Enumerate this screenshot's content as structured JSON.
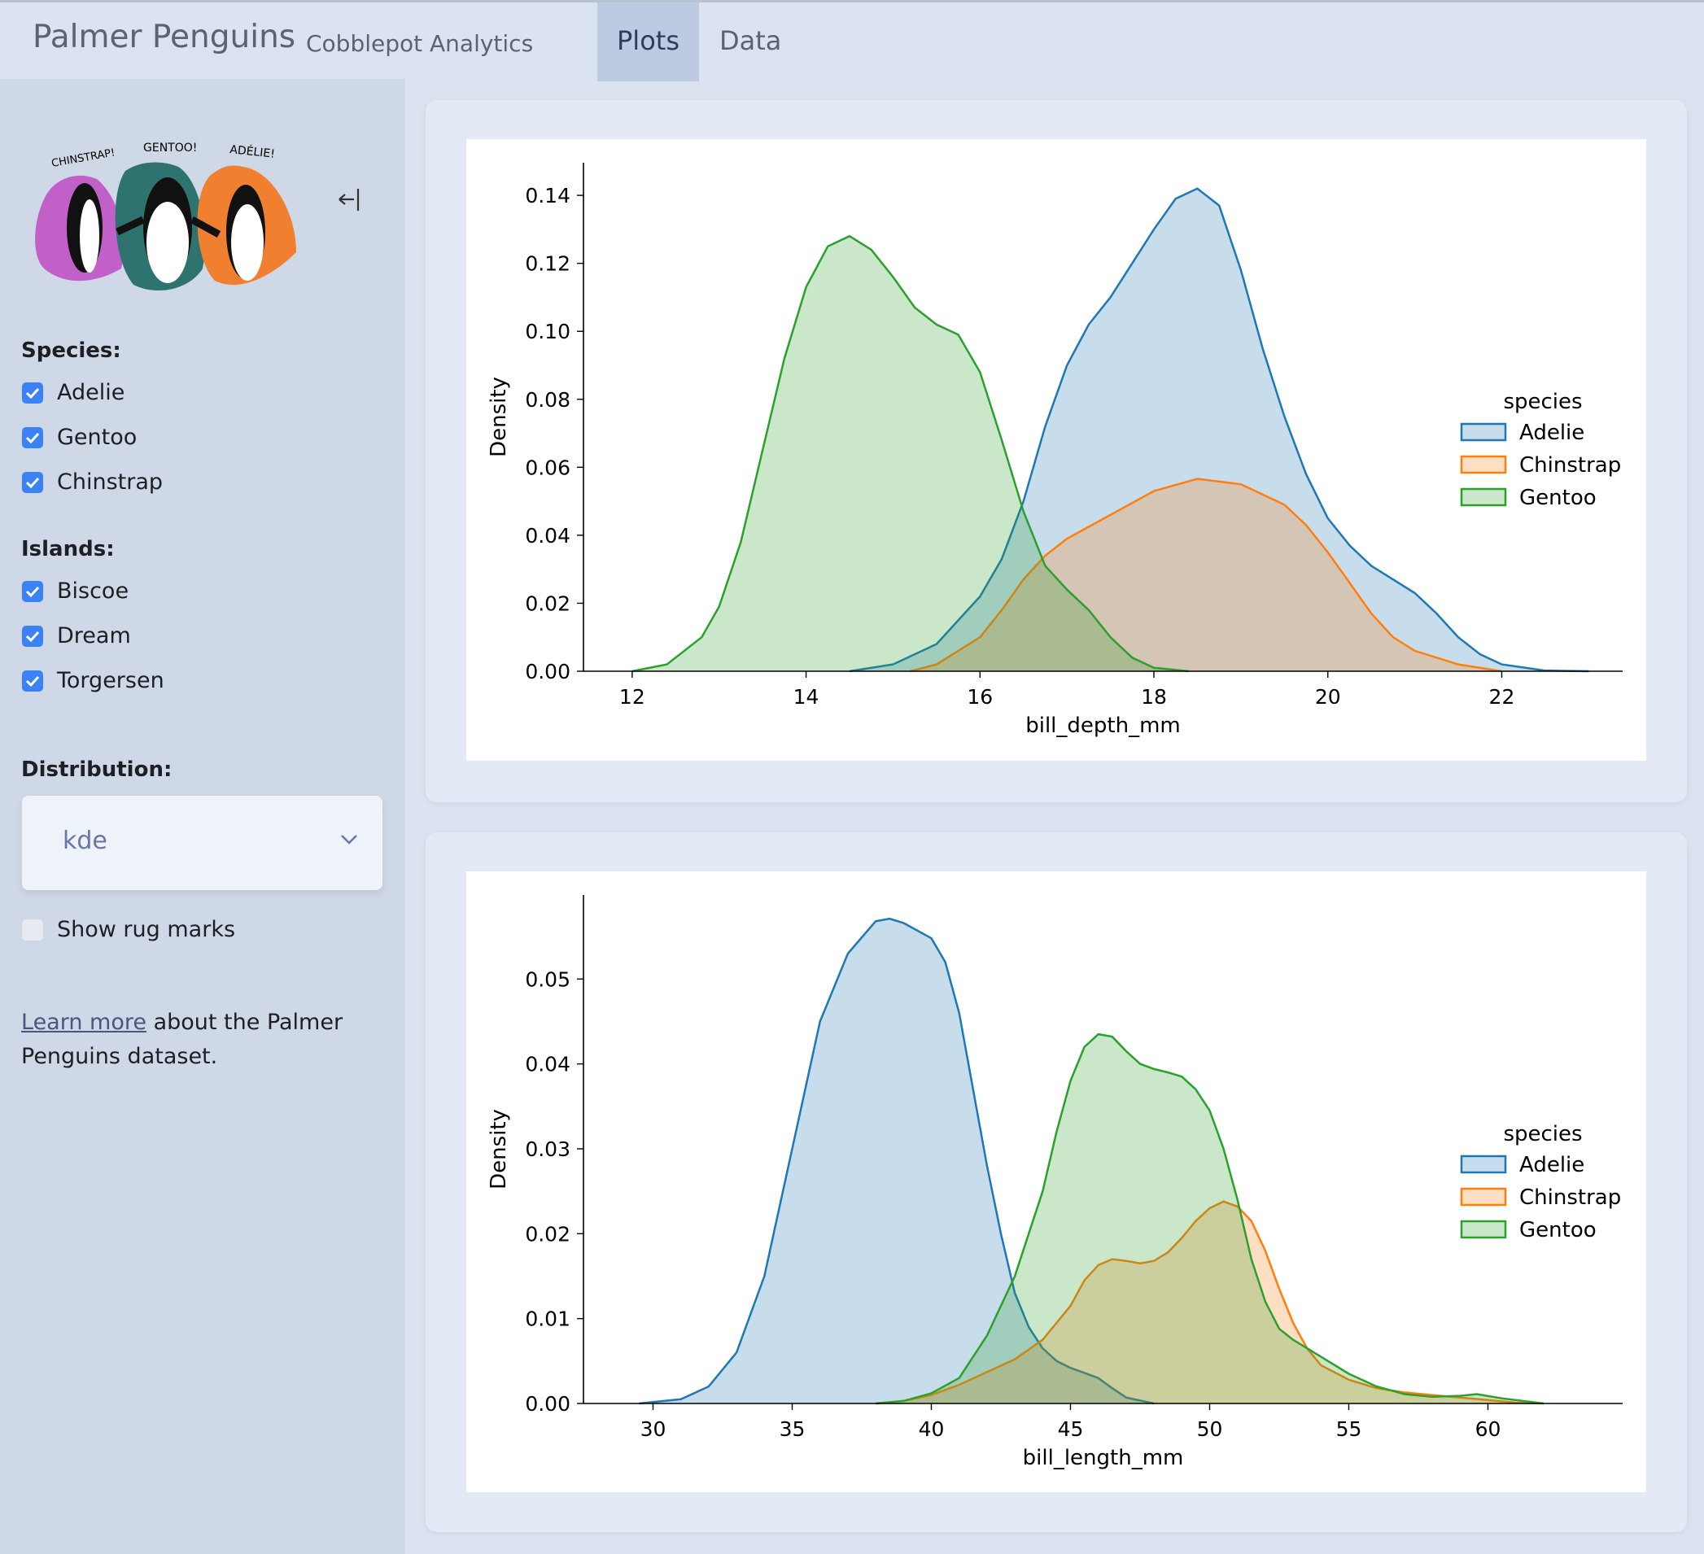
{
  "header": {
    "title": "Palmer Penguins",
    "subtitle": "Cobblepot Analytics",
    "tabs": [
      {
        "label": "Plots",
        "active": true
      },
      {
        "label": "Data",
        "active": false
      }
    ]
  },
  "sidebar": {
    "collapse_icon": "arrow-left-bar-icon",
    "logo_text": [
      "CHINSTRAP!",
      "GENTOO!",
      "ADÉLIE!"
    ],
    "species_label": "Species:",
    "species": [
      {
        "label": "Adelie",
        "checked": true
      },
      {
        "label": "Gentoo",
        "checked": true
      },
      {
        "label": "Chinstrap",
        "checked": true
      }
    ],
    "islands_label": "Islands:",
    "islands": [
      {
        "label": "Biscoe",
        "checked": true
      },
      {
        "label": "Dream",
        "checked": true
      },
      {
        "label": "Torgersen",
        "checked": true
      }
    ],
    "distribution_label": "Distribution:",
    "distribution_value": "kde",
    "rug": {
      "label": "Show rug marks",
      "checked": false
    },
    "learn_link": "Learn more",
    "learn_text": " about the Palmer Penguins dataset."
  },
  "colors": {
    "Adelie": "#1f77b4",
    "Chinstrap": "#ff7f0e",
    "Gentoo": "#2ca02c",
    "checkbox": "#3b82f6"
  },
  "chart_data": [
    {
      "type": "area",
      "xlabel": "bill_depth_mm",
      "ylabel": "Density",
      "xlim": [
        11.44,
        23.39
      ],
      "ylim": [
        0,
        0.1496
      ],
      "xticks": [
        12,
        14,
        16,
        18,
        20,
        22
      ],
      "yticks": [
        0,
        0.02,
        0.04,
        0.06,
        0.08,
        0.1,
        0.12,
        0.14
      ],
      "ytick_decimals": 2,
      "legend": {
        "title": "species",
        "position": "right",
        "entries": [
          "Adelie",
          "Chinstrap",
          "Gentoo"
        ]
      },
      "series": [
        {
          "name": "Adelie",
          "points": [
            [
              14.5,
              0
            ],
            [
              15,
              0.002
            ],
            [
              15.5,
              0.008
            ],
            [
              16,
              0.022
            ],
            [
              16.25,
              0.033
            ],
            [
              16.5,
              0.05
            ],
            [
              16.75,
              0.072
            ],
            [
              17,
              0.09
            ],
            [
              17.25,
              0.102
            ],
            [
              17.5,
              0.11
            ],
            [
              17.75,
              0.12
            ],
            [
              18,
              0.13
            ],
            [
              18.25,
              0.139
            ],
            [
              18.5,
              0.142
            ],
            [
              18.75,
              0.137
            ],
            [
              19,
              0.118
            ],
            [
              19.25,
              0.095
            ],
            [
              19.5,
              0.075
            ],
            [
              19.75,
              0.058
            ],
            [
              20,
              0.045
            ],
            [
              20.25,
              0.037
            ],
            [
              20.5,
              0.031
            ],
            [
              20.75,
              0.027
            ],
            [
              21,
              0.023
            ],
            [
              21.25,
              0.017
            ],
            [
              21.5,
              0.01
            ],
            [
              21.75,
              0.005
            ],
            [
              22,
              0.002
            ],
            [
              22.5,
              0.0002
            ],
            [
              23,
              0
            ]
          ]
        },
        {
          "name": "Chinstrap",
          "points": [
            [
              15.2,
              0
            ],
            [
              15.5,
              0.002
            ],
            [
              16,
              0.01
            ],
            [
              16.25,
              0.018
            ],
            [
              16.5,
              0.027
            ],
            [
              16.75,
              0.034
            ],
            [
              17,
              0.039
            ],
            [
              17.5,
              0.046
            ],
            [
              18,
              0.053
            ],
            [
              18.5,
              0.0566
            ],
            [
              19,
              0.055
            ],
            [
              19.5,
              0.049
            ],
            [
              19.75,
              0.043
            ],
            [
              20,
              0.035
            ],
            [
              20.25,
              0.026
            ],
            [
              20.5,
              0.017
            ],
            [
              20.75,
              0.01
            ],
            [
              21,
              0.006
            ],
            [
              21.5,
              0.002
            ],
            [
              22,
              0
            ]
          ]
        },
        {
          "name": "Gentoo",
          "points": [
            [
              12,
              0
            ],
            [
              12.4,
              0.002
            ],
            [
              12.8,
              0.01
            ],
            [
              13,
              0.019
            ],
            [
              13.25,
              0.038
            ],
            [
              13.5,
              0.065
            ],
            [
              13.75,
              0.092
            ],
            [
              14,
              0.113
            ],
            [
              14.25,
              0.125
            ],
            [
              14.5,
              0.128
            ],
            [
              14.75,
              0.124
            ],
            [
              15,
              0.116
            ],
            [
              15.25,
              0.107
            ],
            [
              15.5,
              0.102
            ],
            [
              15.75,
              0.099
            ],
            [
              16,
              0.088
            ],
            [
              16.25,
              0.068
            ],
            [
              16.5,
              0.047
            ],
            [
              16.75,
              0.031
            ],
            [
              17,
              0.024
            ],
            [
              17.25,
              0.018
            ],
            [
              17.5,
              0.01
            ],
            [
              17.75,
              0.004
            ],
            [
              18,
              0.001
            ],
            [
              18.4,
              0
            ]
          ]
        }
      ]
    },
    {
      "type": "area",
      "xlabel": "bill_length_mm",
      "ylabel": "Density",
      "xlim": [
        27.5,
        64.84
      ],
      "ylim": [
        0,
        0.0599
      ],
      "xticks": [
        30,
        35,
        40,
        45,
        50,
        55,
        60
      ],
      "yticks": [
        0,
        0.01,
        0.02,
        0.03,
        0.04,
        0.05
      ],
      "ytick_decimals": 2,
      "legend": {
        "title": "species",
        "position": "right",
        "entries": [
          "Adelie",
          "Chinstrap",
          "Gentoo"
        ]
      },
      "series": [
        {
          "name": "Adelie",
          "points": [
            [
              29.5,
              0
            ],
            [
              31,
              0.0005
            ],
            [
              32,
              0.002
            ],
            [
              33,
              0.006
            ],
            [
              34,
              0.015
            ],
            [
              35,
              0.03
            ],
            [
              36,
              0.045
            ],
            [
              37,
              0.053
            ],
            [
              38,
              0.0568
            ],
            [
              38.5,
              0.0571
            ],
            [
              39,
              0.0566
            ],
            [
              40,
              0.0548
            ],
            [
              40.5,
              0.052
            ],
            [
              41,
              0.046
            ],
            [
              41.5,
              0.037
            ],
            [
              42,
              0.028
            ],
            [
              42.5,
              0.02
            ],
            [
              43,
              0.013
            ],
            [
              43.5,
              0.009
            ],
            [
              44,
              0.0065
            ],
            [
              44.5,
              0.005
            ],
            [
              45,
              0.0042
            ],
            [
              46,
              0.003
            ],
            [
              46.5,
              0.0018
            ],
            [
              47,
              0.0007
            ],
            [
              48,
              0
            ]
          ]
        },
        {
          "name": "Chinstrap",
          "points": [
            [
              38,
              0
            ],
            [
              39,
              0.0003
            ],
            [
              40,
              0.001
            ],
            [
              41,
              0.0022
            ],
            [
              42,
              0.0037
            ],
            [
              43,
              0.0052
            ],
            [
              44,
              0.0075
            ],
            [
              45,
              0.0115
            ],
            [
              45.5,
              0.0145
            ],
            [
              46,
              0.0163
            ],
            [
              46.5,
              0.017
            ],
            [
              47,
              0.0168
            ],
            [
              47.5,
              0.0165
            ],
            [
              48,
              0.0168
            ],
            [
              48.5,
              0.0178
            ],
            [
              49,
              0.0195
            ],
            [
              49.5,
              0.0215
            ],
            [
              50,
              0.023
            ],
            [
              50.5,
              0.0238
            ],
            [
              51,
              0.0232
            ],
            [
              51.5,
              0.0215
            ],
            [
              52,
              0.018
            ],
            [
              52.5,
              0.0135
            ],
            [
              53,
              0.0095
            ],
            [
              53.5,
              0.0065
            ],
            [
              54,
              0.0045
            ],
            [
              55,
              0.0028
            ],
            [
              56,
              0.0018
            ],
            [
              57,
              0.0013
            ],
            [
              58,
              0.001
            ],
            [
              59,
              0.0007
            ],
            [
              60,
              0.0004
            ],
            [
              61,
              0.0001
            ],
            [
              62,
              0
            ]
          ]
        },
        {
          "name": "Gentoo",
          "points": [
            [
              38,
              0
            ],
            [
              39,
              0.0003
            ],
            [
              40,
              0.0012
            ],
            [
              41,
              0.003
            ],
            [
              42,
              0.008
            ],
            [
              43,
              0.015
            ],
            [
              44,
              0.025
            ],
            [
              44.5,
              0.032
            ],
            [
              45,
              0.038
            ],
            [
              45.5,
              0.042
            ],
            [
              46,
              0.0435
            ],
            [
              46.5,
              0.0432
            ],
            [
              47,
              0.0415
            ],
            [
              47.5,
              0.04
            ],
            [
              48,
              0.0394
            ],
            [
              48.5,
              0.039
            ],
            [
              49,
              0.0385
            ],
            [
              49.5,
              0.037
            ],
            [
              50,
              0.0345
            ],
            [
              50.5,
              0.03
            ],
            [
              51,
              0.024
            ],
            [
              51.5,
              0.017
            ],
            [
              52,
              0.012
            ],
            [
              52.5,
              0.0088
            ],
            [
              53,
              0.0075
            ],
            [
              54,
              0.0055
            ],
            [
              55,
              0.0035
            ],
            [
              56,
              0.002
            ],
            [
              57,
              0.0011
            ],
            [
              58,
              0.0008
            ],
            [
              59,
              0.0009
            ],
            [
              59.6,
              0.0011
            ],
            [
              60.5,
              0.0006
            ],
            [
              62,
              0
            ]
          ]
        }
      ]
    }
  ]
}
